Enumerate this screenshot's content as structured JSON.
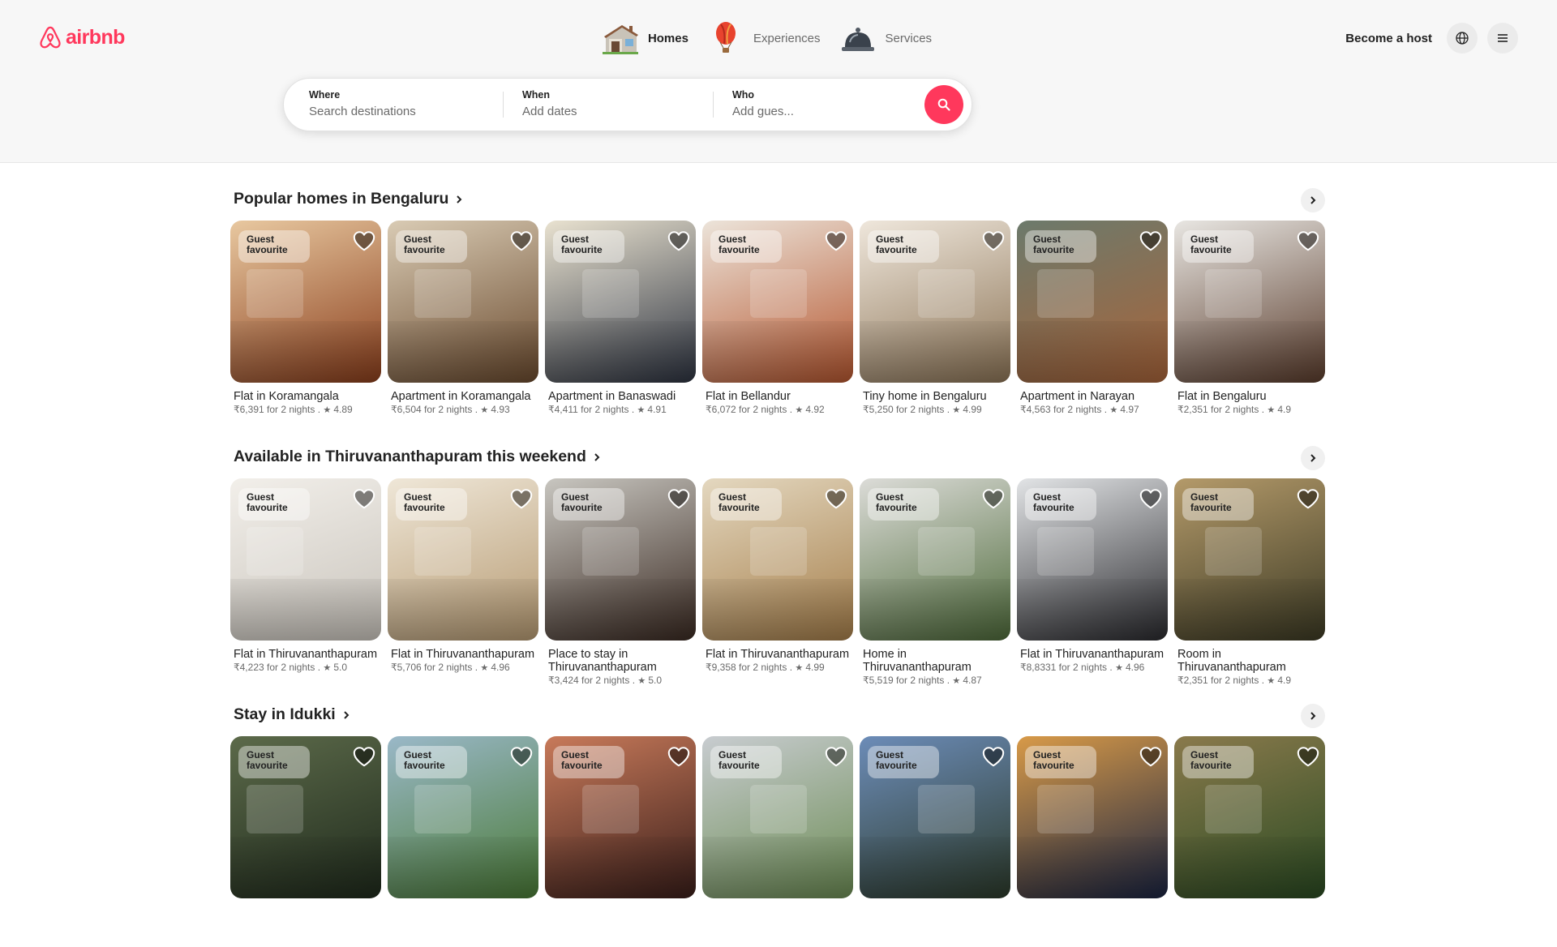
{
  "brand": {
    "name": "airbnb",
    "color": "#ff385c"
  },
  "nav": [
    {
      "label": "Homes",
      "icon": "house-icon",
      "active": true
    },
    {
      "label": "Experiences",
      "icon": "hot-air-balloon-icon",
      "active": false
    },
    {
      "label": "Services",
      "icon": "service-bell-icon",
      "active": false
    }
  ],
  "header_right": {
    "become_host": "Become a host",
    "globe_icon": "globe-icon",
    "menu_icon": "hamburger-menu-icon"
  },
  "search": {
    "where": {
      "label": "Where",
      "placeholder": "Search destinations"
    },
    "when": {
      "label": "When",
      "placeholder": "Add dates"
    },
    "who": {
      "label": "Who",
      "placeholder": "Add gues..."
    },
    "button_icon": "search-icon"
  },
  "sections": [
    {
      "title": "Popular homes in Bengaluru",
      "listings": [
        {
          "badge": "Guest favourite",
          "title": "Flat in Koramangala",
          "price": "₹6,391 for 2 nights",
          "rating": "4.89",
          "tones": [
            "#8a3e1c",
            "#e8c8a0"
          ]
        },
        {
          "badge": "Guest favourite",
          "title": "Apartment in Koramangala",
          "price": "₹6,504 for 2 nights",
          "rating": "4.93",
          "tones": [
            "#6a4a2e",
            "#d9cbb4"
          ]
        },
        {
          "badge": "Guest favourite",
          "title": "Apartment in Banaswadi",
          "price": "₹4,411 for 2 nights",
          "rating": "4.91",
          "tones": [
            "#2d3340",
            "#e9e2d0"
          ]
        },
        {
          "badge": "Guest favourite",
          "title": "Flat in Bellandur",
          "price": "₹6,072 for 2 nights",
          "rating": "4.92",
          "tones": [
            "#b5562f",
            "#ece4da"
          ]
        },
        {
          "badge": "Guest favourite",
          "title": "Tiny home in Bengaluru",
          "price": "₹5,250 for 2 nights",
          "rating": "4.99",
          "tones": [
            "#8c7456",
            "#efe7dc"
          ]
        },
        {
          "badge": "Guest favourite",
          "title": "Apartment in Narayan",
          "price": "₹4,563 for 2 nights",
          "rating": "4.97",
          "tones": [
            "#a8643a",
            "#6c7a6c"
          ]
        },
        {
          "badge": "Guest favourite",
          "title": "Flat in Bengaluru",
          "price": "₹2,351 for 2 nights",
          "rating": "4.9",
          "tones": [
            "#5a3c2c",
            "#e8e6e2"
          ]
        }
      ]
    },
    {
      "title": "Available in Thiruvananthapuram this weekend",
      "listings": [
        {
          "badge": "Guest favourite",
          "title": "Flat in Thiruvananthapuram",
          "price": "₹4,223 for 2 nights",
          "rating": "5.0",
          "tones": [
            "#c9c4bc",
            "#f2efea"
          ]
        },
        {
          "badge": "Guest favourite",
          "title": "Flat in Thiruvananthapuram",
          "price": "₹5,706 for 2 nights",
          "rating": "4.96",
          "tones": [
            "#b69a72",
            "#efe7d8"
          ]
        },
        {
          "badge": "Guest favourite",
          "title": "Place to stay in Thiruvananthapuram",
          "price": "₹3,424 for 2 nights",
          "rating": "5.0",
          "tones": [
            "#3a2a22",
            "#c8c6c0"
          ]
        },
        {
          "badge": "Guest favourite",
          "title": "Flat in Thiruvananthapuram",
          "price": "₹9,358 for 2 nights",
          "rating": "4.99",
          "tones": [
            "#a57e4a",
            "#e4d8c0"
          ]
        },
        {
          "badge": "Guest favourite",
          "title": "Home in Thiruvananthapuram",
          "price": "₹5,519 for 2 nights",
          "rating": "4.87",
          "tones": [
            "#4e6a3a",
            "#dcdcd8"
          ]
        },
        {
          "badge": "Guest favourite",
          "title": "Flat in Thiruvananthapuram",
          "price": "₹8,8331 for 2 nights",
          "rating": "4.96",
          "tones": [
            "#2a2a2e",
            "#e2e4e6"
          ]
        },
        {
          "badge": "Guest favourite",
          "title": "Room in Thiruvananthapuram",
          "price": "₹2,351 for 2 nights",
          "rating": "4.9",
          "tones": [
            "#3c3a24",
            "#b49a6a"
          ]
        }
      ]
    },
    {
      "title": "Stay in Idukki",
      "listings": [
        {
          "badge": "Guest favourite",
          "title": "",
          "price": "",
          "rating": "",
          "tones": [
            "#1f2a1c",
            "#5c6a4a"
          ]
        },
        {
          "badge": "Guest favourite",
          "title": "",
          "price": "",
          "rating": "",
          "tones": [
            "#4a7a36",
            "#9ab8c8"
          ]
        },
        {
          "badge": "Guest favourite",
          "title": "",
          "price": "",
          "rating": "",
          "tones": [
            "#3a1e1a",
            "#c87a5a"
          ]
        },
        {
          "badge": "Guest favourite",
          "title": "",
          "price": "",
          "rating": "",
          "tones": [
            "#6c8c54",
            "#c8ccd0"
          ]
        },
        {
          "badge": "Guest favourite",
          "title": "",
          "price": "",
          "rating": "",
          "tones": [
            "#2c3a2a",
            "#6c8cb8"
          ]
        },
        {
          "badge": "Guest favourite",
          "title": "",
          "price": "",
          "rating": "",
          "tones": [
            "#1a2442",
            "#d89a48"
          ]
        },
        {
          "badge": "Guest favourite",
          "title": "",
          "price": "",
          "rating": "",
          "tones": [
            "#2a4a22",
            "#8a7a4c"
          ]
        }
      ]
    }
  ]
}
